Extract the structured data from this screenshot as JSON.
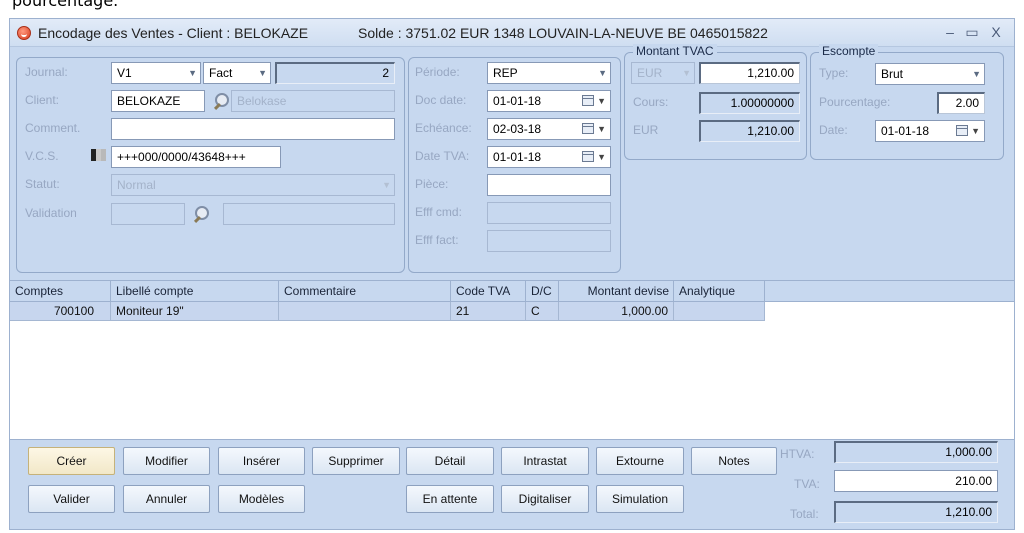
{
  "cut_text": "pourcentage.",
  "window": {
    "title": "Encodage des Ventes - Client : BELOKAZE",
    "solde": "Solde : 3751.02 EUR 1348 LOUVAIN-LA-NEUVE BE 0465015822",
    "min_glyph": "–",
    "max_glyph": "▭",
    "close_glyph": "X"
  },
  "left_panel": {
    "journal_label": "Journal:",
    "journal_value": "V1",
    "type_value": "Fact",
    "number_value": "2",
    "client_label": "Client:",
    "client_value": "BELOKAZE",
    "client_name": "Belokase",
    "comment_label": "Comment.",
    "comment_value": "",
    "vcs_label": "V.C.S.",
    "vcs_value": "+++000/0000/43648+++",
    "statut_label": "Statut:",
    "statut_value": "Normal",
    "validation_label": "Validation",
    "validation_value": "",
    "validation_value2": ""
  },
  "middle_panel": {
    "periode_label": "Période:",
    "periode_value": "REP",
    "docdate_label": "Doc date:",
    "docdate_value": "01-01-18",
    "echeance_label": "Echéance:",
    "echeance_value": "02-03-18",
    "datetva_label": "Date TVA:",
    "datetva_value": "01-01-18",
    "piece_label": "Pièce:",
    "piece_value": "",
    "efffcmd_label": "Efff cmd:",
    "efffcmd_value": "",
    "effffact_label": "Efff fact:",
    "effffact_value": ""
  },
  "montant_tvac": {
    "title": "Montant TVAC",
    "currency": "EUR",
    "amount": "1,210.00",
    "cours_label": "Cours:",
    "cours_value": "1.00000000",
    "eur_label": "EUR",
    "eur_value": "1,210.00"
  },
  "escompte": {
    "title": "Escompte",
    "type_label": "Type:",
    "type_value": "Brut",
    "pourcentage_label": "Pourcentage:",
    "pourcentage_value": "2.00",
    "date_label": "Date:",
    "date_value": "01-01-18"
  },
  "grid": {
    "headers": [
      "Comptes",
      "Libellé compte",
      "Commentaire",
      "Code TVA",
      "D/C",
      "Montant devise",
      "Analytique"
    ],
    "rows": [
      [
        "700100",
        "Moniteur 19\"",
        "",
        "21",
        "C",
        "1,000.00",
        ""
      ]
    ]
  },
  "buttons": {
    "creer": "Créer",
    "modifier": "Modifier",
    "inserer": "Insérer",
    "supprimer": "Supprimer",
    "detail": "Détail",
    "intrastat": "Intrastat",
    "extourne": "Extourne",
    "notes": "Notes",
    "valider": "Valider",
    "annuler": "Annuler",
    "modeles": "Modèles",
    "en_attente": "En attente",
    "digitaliser": "Digitaliser",
    "simulation": "Simulation"
  },
  "totals": {
    "htva_label": "HTVA:",
    "htva_value": "1,000.00",
    "tva_label": "TVA:",
    "tva_value": "210.00",
    "total_label": "Total:",
    "total_value": "1,210.00"
  }
}
